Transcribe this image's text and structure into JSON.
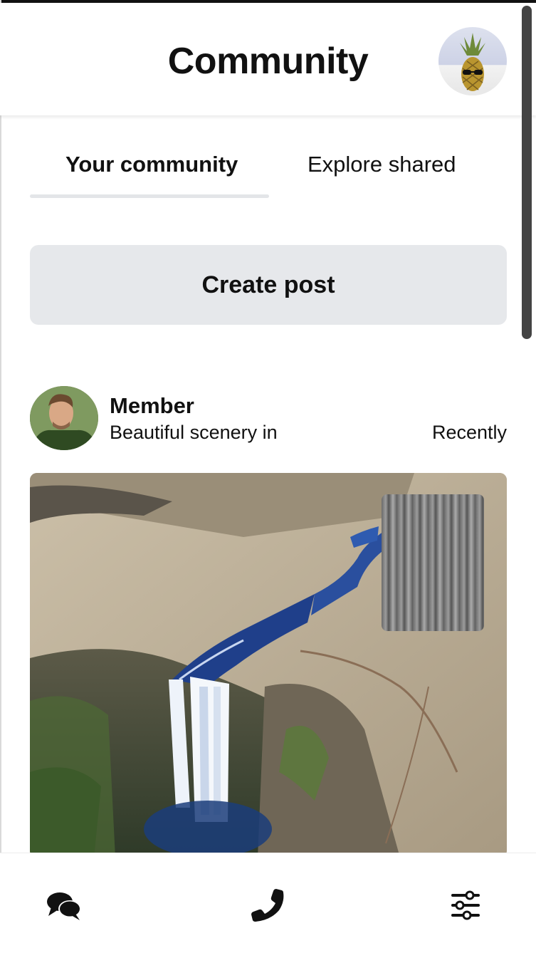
{
  "header": {
    "title": "Community",
    "profile_icon": "profile-avatar"
  },
  "tabs": [
    {
      "label": "Your community",
      "active": true
    },
    {
      "label": "Explore shared",
      "active": false
    }
  ],
  "create_post": {
    "label": "Create post"
  },
  "post": {
    "author": "Member",
    "text": "Beautiful scenery in",
    "time": "Recently",
    "image": "waterfall-aerial-photo"
  },
  "bottom_nav": {
    "items": [
      {
        "icon": "chat-bubbles-icon"
      },
      {
        "icon": "phone-icon"
      },
      {
        "icon": "sliders-icon"
      }
    ]
  },
  "colors": {
    "button_bg": "#e6e8eb",
    "tab_underline": "#e3e5e8",
    "text": "#111111"
  }
}
